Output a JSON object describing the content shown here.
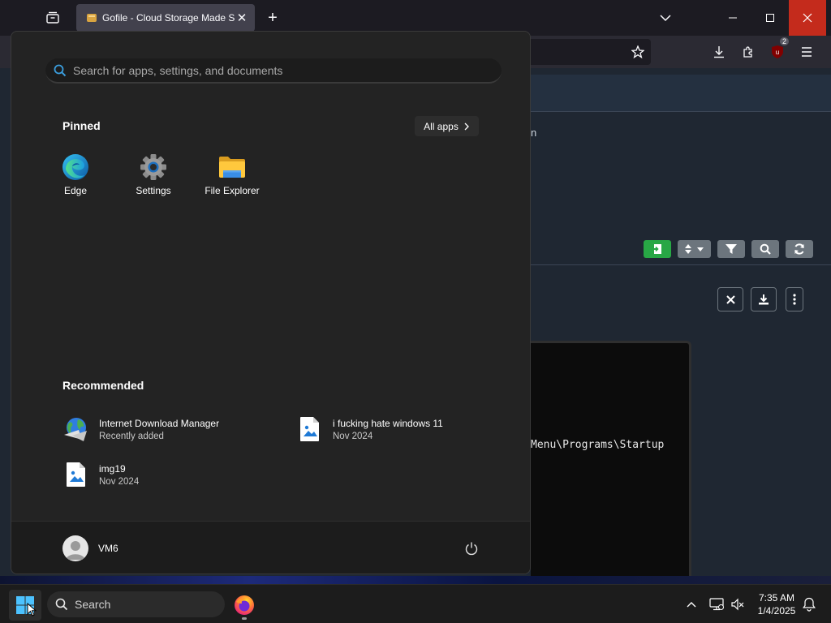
{
  "browser": {
    "tab_title": "Gofile - Cloud Storage Made Si",
    "downloads_badge": "2"
  },
  "page": {
    "partial_text": "n",
    "terminal_line": "Menu\\Programs\\Startup"
  },
  "start_menu": {
    "search_placeholder": "Search for apps, settings, and documents",
    "pinned_title": "Pinned",
    "all_apps_label": "All apps",
    "pinned": [
      {
        "label": "Edge",
        "icon": "edge-icon"
      },
      {
        "label": "Settings",
        "icon": "settings-gear-icon"
      },
      {
        "label": "File Explorer",
        "icon": "folder-icon"
      }
    ],
    "recommended_title": "Recommended",
    "recommended": [
      {
        "name": "Internet Download Manager",
        "sub": "Recently added",
        "icon": "idm-globe-icon"
      },
      {
        "name": "i fucking hate windows 11",
        "sub": "Nov 2024",
        "icon": "image-file-icon"
      },
      {
        "name": "img19",
        "sub": "Nov 2024",
        "icon": "image-file-icon"
      }
    ],
    "user_name": "VM6"
  },
  "taskbar": {
    "search_label": "Search",
    "time": "7:35 AM",
    "date": "1/4/2025"
  },
  "colors": {
    "accent_blue": "#0078d4",
    "close_red": "#c42b1c",
    "start_bg": "#232323",
    "green_button": "#28a745"
  }
}
